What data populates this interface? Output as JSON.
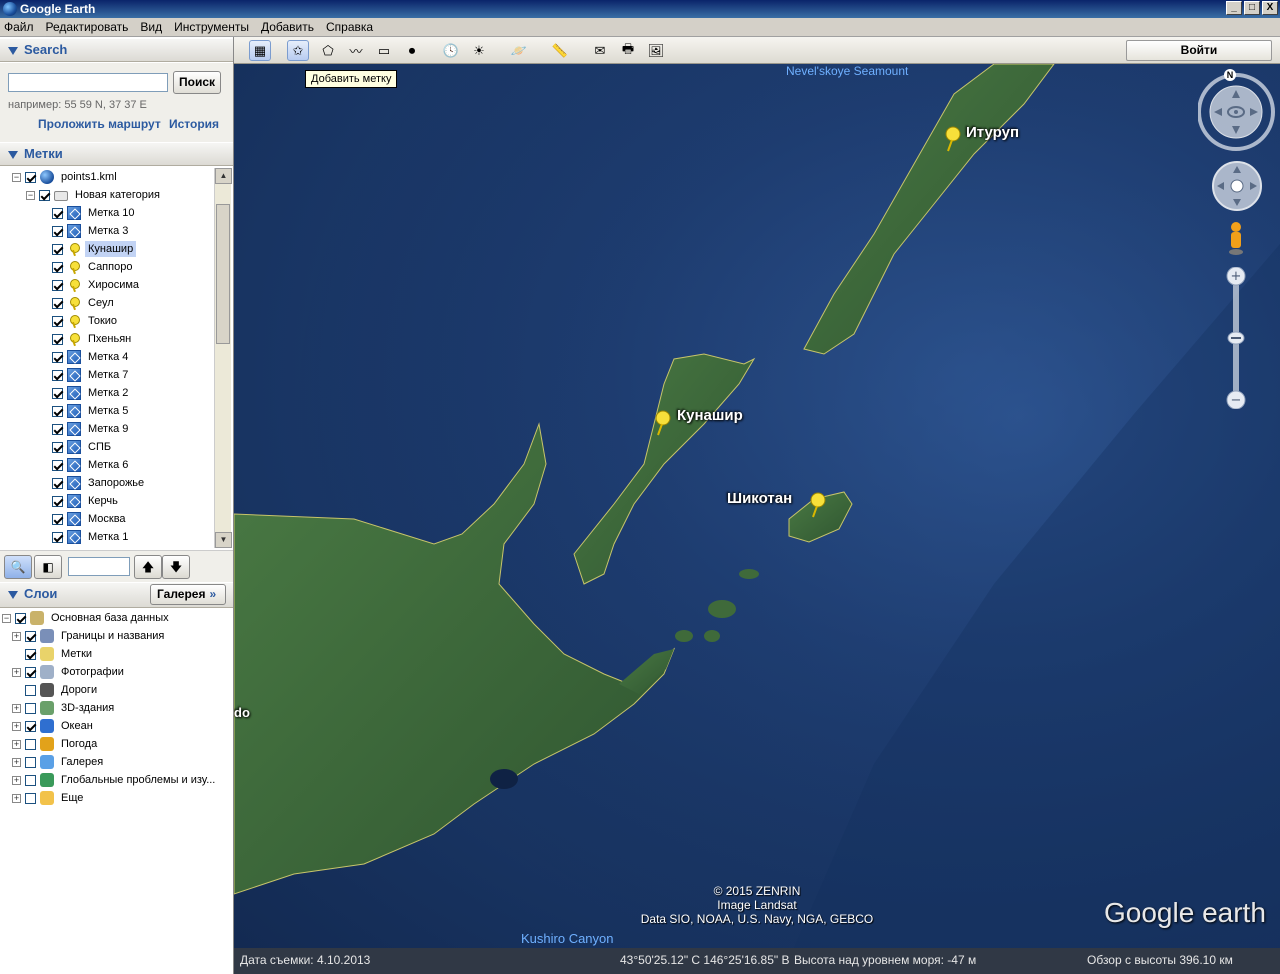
{
  "window": {
    "title": "Google Earth",
    "min": "_",
    "max": "□",
    "close": "X"
  },
  "menu": [
    "Файл",
    "Редактировать",
    "Вид",
    "Инструменты",
    "Добавить",
    "Справка"
  ],
  "search": {
    "header": "Search",
    "input_value": "",
    "button": "Поиск",
    "hint": "например: 55 59 N, 37 37 E",
    "directions_link": "Проложить маршрут",
    "history_link": "История"
  },
  "places": {
    "header": "Метки",
    "root": "points1.kml",
    "folder": "Новая категория",
    "items": [
      {
        "label": "Метка 10",
        "icon": "placemark-icon",
        "selected": false
      },
      {
        "label": "Метка 3",
        "icon": "placemark-icon",
        "selected": false
      },
      {
        "label": "Кунашир",
        "icon": "pushpin-icon",
        "selected": true
      },
      {
        "label": "Саппоро",
        "icon": "pushpin-icon",
        "selected": false
      },
      {
        "label": "Хиросима",
        "icon": "pushpin-icon",
        "selected": false
      },
      {
        "label": "Сеул",
        "icon": "pushpin-icon",
        "selected": false
      },
      {
        "label": "Токио",
        "icon": "pushpin-icon",
        "selected": false
      },
      {
        "label": "Пхеньян",
        "icon": "pushpin-icon",
        "selected": false
      },
      {
        "label": "Метка 4",
        "icon": "placemark-icon",
        "selected": false
      },
      {
        "label": "Метка 7",
        "icon": "placemark-icon",
        "selected": false
      },
      {
        "label": "Метка 2",
        "icon": "placemark-icon",
        "selected": false
      },
      {
        "label": "Метка 5",
        "icon": "placemark-icon",
        "selected": false
      },
      {
        "label": "Метка 9",
        "icon": "placemark-icon",
        "selected": false
      },
      {
        "label": "СПБ",
        "icon": "placemark-icon",
        "selected": false
      },
      {
        "label": "Метка 6",
        "icon": "placemark-icon",
        "selected": false
      },
      {
        "label": "Запорожье",
        "icon": "placemark-icon",
        "selected": false
      },
      {
        "label": "Керчь",
        "icon": "placemark-icon",
        "selected": false
      },
      {
        "label": "Москва",
        "icon": "placemark-icon",
        "selected": false
      },
      {
        "label": "Метка 1",
        "icon": "placemark-icon",
        "selected": false
      }
    ],
    "search_input_value": ""
  },
  "layers": {
    "header": "Слои",
    "gallery_button": "Галерея",
    "gallery_arrow": "»",
    "items": [
      {
        "label": "Основная база данных",
        "checked": true,
        "icon": "layers-db-icon"
      },
      {
        "label": "Границы и названия",
        "checked": true,
        "icon": "borders-icon"
      },
      {
        "label": "Метки",
        "checked": true,
        "icon": "places-icon"
      },
      {
        "label": "Фотографии",
        "checked": true,
        "icon": "photos-icon"
      },
      {
        "label": "Дороги",
        "checked": false,
        "icon": "roads-icon"
      },
      {
        "label": "3D-здания",
        "checked": false,
        "icon": "buildings-icon"
      },
      {
        "label": "Океан",
        "checked": true,
        "icon": "ocean-icon"
      },
      {
        "label": "Погода",
        "checked": false,
        "icon": "weather-icon"
      },
      {
        "label": "Галерея",
        "checked": false,
        "icon": "gallery-icon"
      },
      {
        "label": "Глобальные проблемы и изу...",
        "checked": false,
        "icon": "globe-icon"
      },
      {
        "label": "Еще",
        "checked": false,
        "icon": "more-icon"
      }
    ]
  },
  "toolbar": {
    "tooltip": "Добавить метку",
    "login": "Войти"
  },
  "map": {
    "labels": {
      "iturup": "Итуруп",
      "kunashir": "Кунашир",
      "shikotan": "Шикотан",
      "edge": "do"
    },
    "seamount": "Nevel'skoye Seamount",
    "canyon": "Kushiro Canyon",
    "attribution": [
      "© 2015 ZENRIN",
      "Image Landsat",
      "Data SIO, NOAA, U.S. Navy, NGA, GEBCO"
    ],
    "logo": "Google earth",
    "compass_north": "N"
  },
  "status": {
    "date": "Дата съемки: 4.10.2013",
    "coords": "43°50'25.12\" С  146°25'16.85\" В",
    "elevation": "Высота над уровнем моря:   -47 м",
    "eye_alt": "Обзор с высоты   396.10 км"
  },
  "colors": {
    "accent": "#2c5aa0",
    "land": "#3f6a3a",
    "sea": "#1e3d72",
    "pin": "#f7e03a"
  }
}
